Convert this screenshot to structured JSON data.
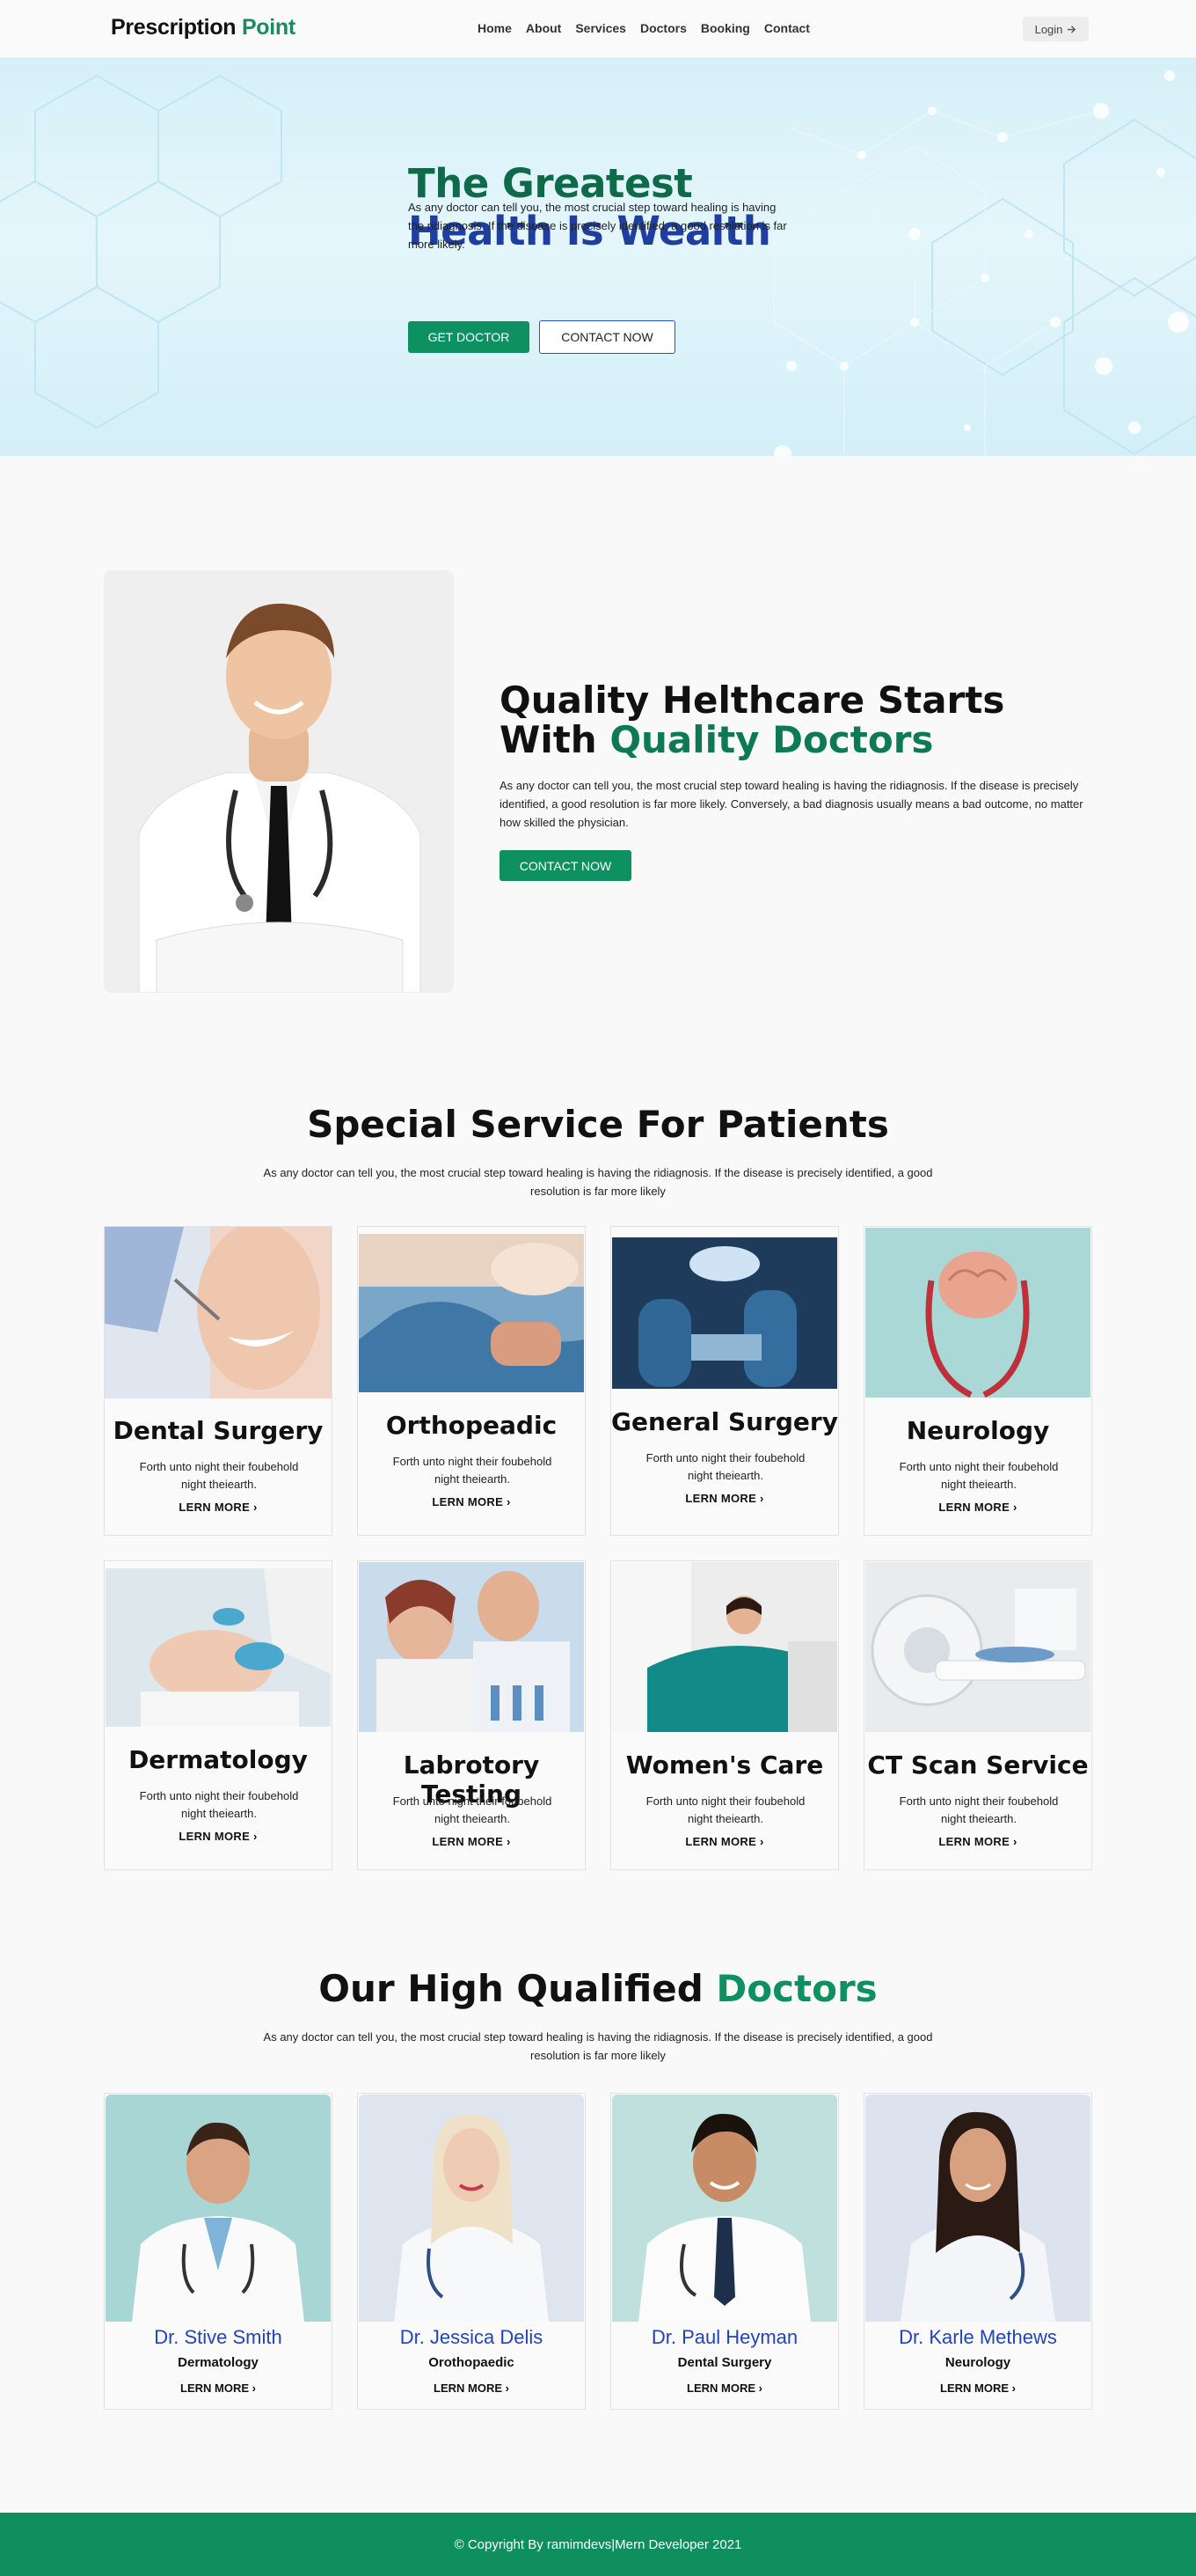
{
  "nav": {
    "brand_main": "Prescription",
    "brand_accent": "Point",
    "menu": [
      "Home",
      "About",
      "Services",
      "Doctors",
      "Booking",
      "Contact"
    ],
    "login": "Login",
    "login_icon": "arrow-right-icon"
  },
  "hero": {
    "title_line1": "The Greatest",
    "title_line2": "Health Is Wealth",
    "description": "As any doctor can tell you, the most crucial step toward healing is having the ridiagnosis. If the disease is precisely identified, a good resolution is far more likely.",
    "primary_button": "GET DOCTOR",
    "secondary_button": "CONTACT NOW"
  },
  "quality": {
    "title_line1": "Quality Helthcare Starts",
    "title_line2_plain": "With",
    "title_line2_accent": "Quality Doctors",
    "description": "As any doctor can tell you, the most crucial step toward healing is having the ridiagnosis. If the disease is precisely identified, a good resolution is far more likely. Conversely, a bad diagnosis usually means a bad outcome, no matter how skilled the physician.",
    "button": "CONTACT NOW"
  },
  "services": {
    "title": "Special Service For Patients",
    "description": "As any doctor can tell you, the most crucial step toward healing is having the ridiagnosis. If the disease is precisely identified, a good resolution is far more likely",
    "items": [
      {
        "title": "Dental Surgery",
        "text": "Forth unto night their foubehold night theiearth.",
        "link": "LERN MORE"
      },
      {
        "title": "Orthopeadic",
        "text": "Forth unto night their foubehold night theiearth.",
        "link": "LERN MORE"
      },
      {
        "title": "General Surgery",
        "text": "Forth unto night their foubehold night theiearth.",
        "link": "LERN MORE"
      },
      {
        "title": "Neurology",
        "text": "Forth unto night their foubehold night theiearth.",
        "link": "LERN MORE"
      },
      {
        "title": "Dermatology",
        "text": "Forth unto night their foubehold night theiearth.",
        "link": "LERN MORE"
      },
      {
        "title": "Labrotory Testing",
        "text": "Forth unto night their foubehold night theiearth.",
        "link": "LERN MORE"
      },
      {
        "title": "Women's Care",
        "text": "Forth unto night their foubehold night theiearth.",
        "link": "LERN MORE"
      },
      {
        "title": "CT Scan Service",
        "text": "Forth unto night their foubehold night theiearth.",
        "link": "LERN MORE"
      }
    ]
  },
  "doctors": {
    "title_plain": "Our High Qualified",
    "title_accent": "Doctors",
    "description": "As any doctor can tell you, the most crucial step toward healing is having the ridiagnosis. If the disease is precisely identified, a good resolution is far more likely",
    "items": [
      {
        "name": "Dr. Stive Smith",
        "specialty": "Dermatology",
        "link": "LERN MORE"
      },
      {
        "name": "Dr. Jessica Delis",
        "specialty": "Orothopaedic",
        "link": "LERN MORE"
      },
      {
        "name": "Dr. Paul Heyman",
        "specialty": "Dental Surgery",
        "link": "LERN MORE"
      },
      {
        "name": "Dr. Karle Methews",
        "specialty": "Neurology",
        "link": "LERN MORE"
      }
    ]
  },
  "footer": {
    "text": "© Copyright By ramimdevs|Mern Developer 2021"
  },
  "colors": {
    "accent_green": "#0e9160",
    "accent_blue": "#1f3ea0",
    "hero_bg": "#d6f0f8"
  }
}
